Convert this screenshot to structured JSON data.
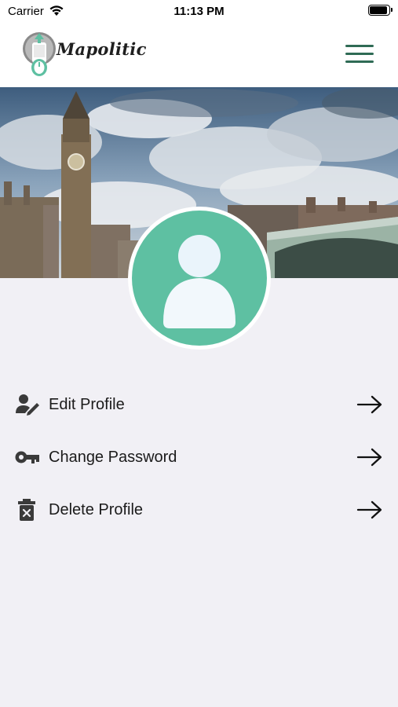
{
  "status_bar": {
    "carrier": "Carrier",
    "time": "11:13 PM"
  },
  "header": {
    "app_name": "Mapolitic",
    "menu_icon": "hamburger-menu-icon",
    "accent_color": "#2f6b55"
  },
  "banner": {
    "scene": "london-skyline-photo"
  },
  "profile": {
    "avatar_color": "#5ec0a2"
  },
  "menu": {
    "items": [
      {
        "label": "Edit Profile",
        "icon": "user-edit-icon"
      },
      {
        "label": "Change Password",
        "icon": "key-icon"
      },
      {
        "label": "Delete Profile",
        "icon": "trash-icon"
      }
    ],
    "arrow_icon": "arrow-right-icon"
  }
}
